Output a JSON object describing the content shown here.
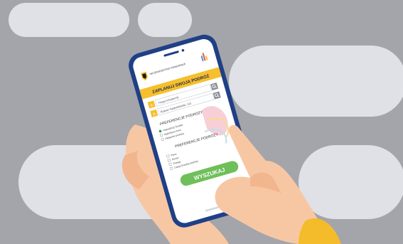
{
  "colors": {
    "background": "#a3a5ab",
    "pill": "#dfe1e6",
    "phone_frame": "#1f3f86",
    "accent_yellow": "#f6bf2e",
    "search_button": "#6fbf5a",
    "skin": "#f7c7a4",
    "sleeve": "#f4bb2b"
  },
  "app": {
    "header_logo_text": "WOJEWÓDZTWO POMORSKIE",
    "banner_title": "ZAPLANUJ SWOJĄ PODRÓŻ",
    "from_label": "A",
    "from_value": "Trasja Ichstlanrik",
    "to_label": "B",
    "to_value": "Bulwar Nadwiślański, Gd",
    "section1_title": "PREFERENCJE PODRÓŻY",
    "section1_options": [
      "Najszybszy Środek",
      "Najkrótsza trasa",
      "Wygodne podróży"
    ],
    "section2_title": "PREFERENCJE PODRÓŻY",
    "section2_options": [
      "Piesz",
      "Rower",
      "Pociąg",
      "Dodaj Ścieżkę podróży"
    ],
    "search_button": "WYSZUKAJ"
  },
  "icons": [
    "pomorskie-logo-icon",
    "app-logo-icon",
    "search-icon",
    "radio-icon",
    "checkbox-icon"
  ]
}
